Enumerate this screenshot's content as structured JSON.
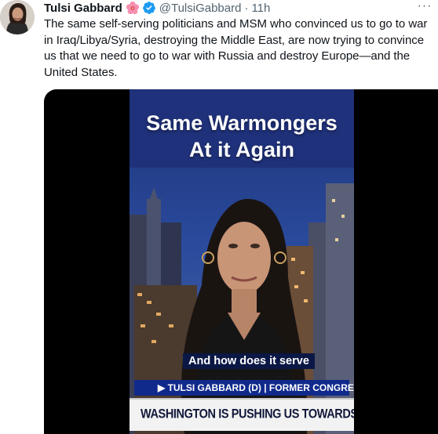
{
  "tweet": {
    "author_name": "Tulsi Gabbard",
    "author_handle": "@TulsiGabbard",
    "separator": "·",
    "time": "11h",
    "more_label": "···",
    "text": "The same self-serving politicians and MSM who convinced us to go to war in Iraq/Libya/Syria, destroying the Middle East, are now trying to convince us that we need to go to war with Russia and destroy Europe—and the United States.",
    "flower_icon": "hibiscus-emoji-icon",
    "verified_icon": "verified-badge-icon",
    "verified_color": "#1d9bf0"
  },
  "video": {
    "headline_line1": "Same Warmongers",
    "headline_line2": "At it Again",
    "caption": "And how does it serve",
    "lower_third_name": "▶ TULSI GABBARD (D) | FORMER CONGRESSWOMAN",
    "lower_third_banner": "WASHINGTON IS PUSHING US TOWARDS WAR WITH RUSSIA"
  }
}
